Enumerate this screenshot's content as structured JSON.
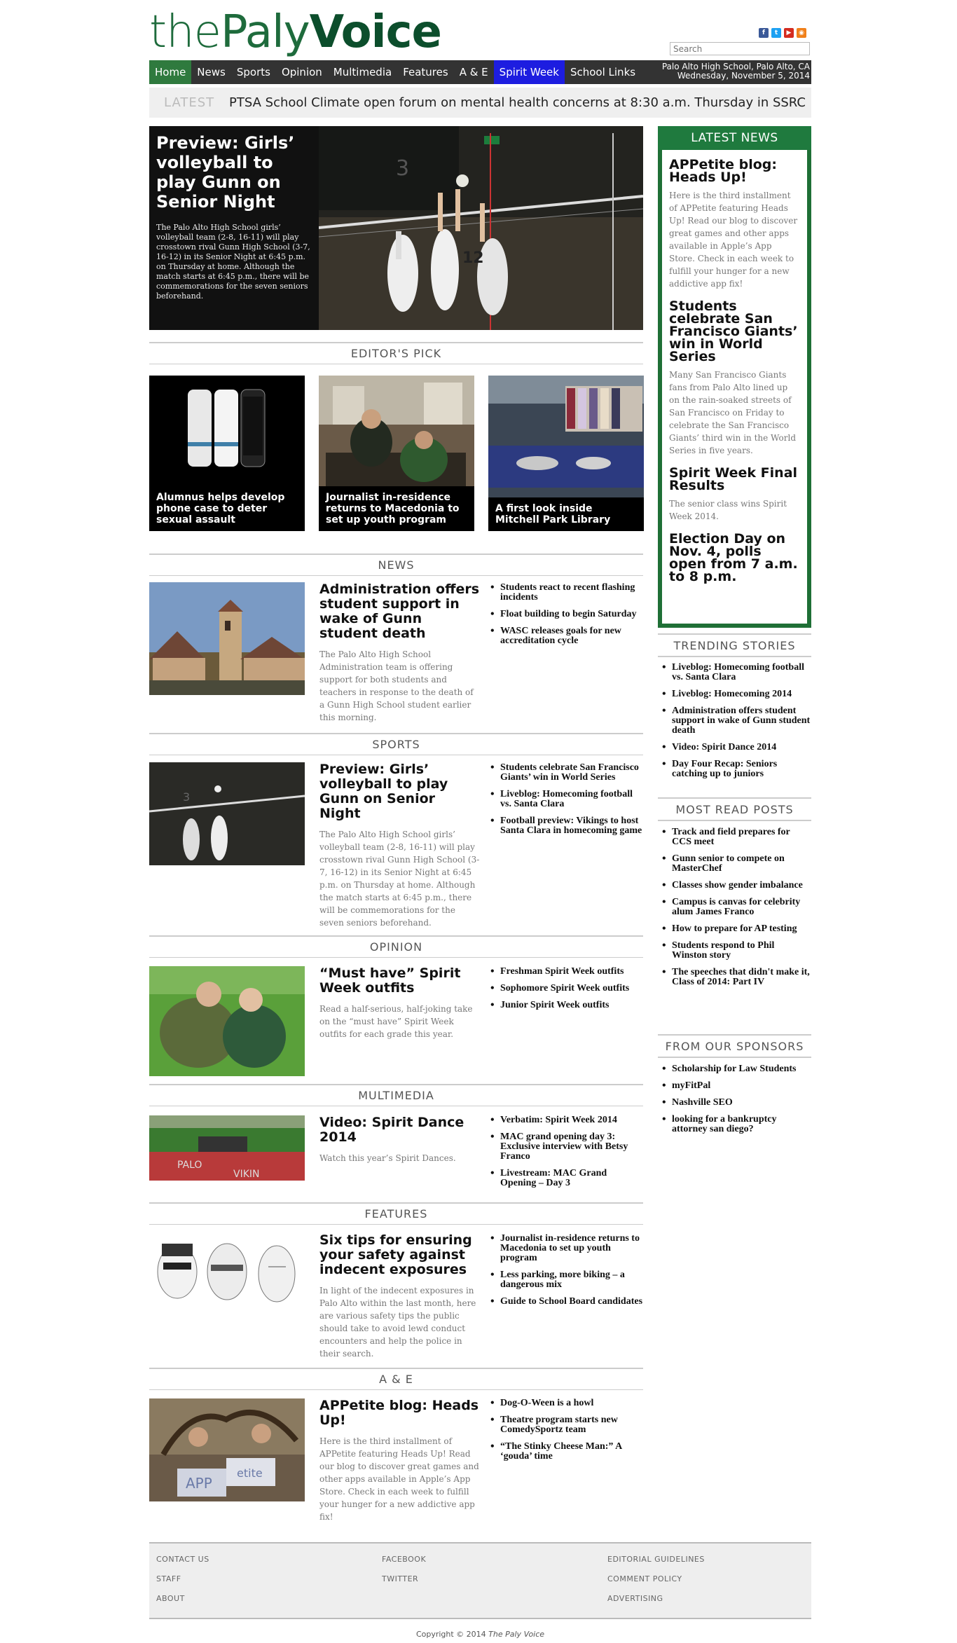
{
  "logo": {
    "part1": "the",
    "part2": "Paly",
    "part3": "Voice"
  },
  "social": {
    "icons": [
      "facebook-icon",
      "twitter-icon",
      "youtube-icon",
      "rss-icon"
    ]
  },
  "search": {
    "placeholder": "Search"
  },
  "nav": {
    "items": [
      "Home",
      "News",
      "Sports",
      "Opinion",
      "Multimedia",
      "Features",
      "A & E",
      "Spirit Week",
      "School Links"
    ],
    "info_line1": "Palo Alto High School, Palo Alto, CA",
    "info_line2": "Wednesday, November 5, 2014"
  },
  "ticker": {
    "label": "LATEST",
    "text": "PTSA School Climate open forum on mental health concerns at 8:30 a.m. Thursday in SSRC"
  },
  "hero": {
    "title": "Preview: Girls’ volleyball to play Gunn on Senior Night",
    "summary": "The Palo Alto High School girls’ volleyball team (2-8, 16-11) will play crosstown rival Gunn High School (3-7, 16-12) in its Senior Night at 6:45 p.m. on Thursday at home. Although the match starts at 6:45 p.m., there will be commemorations for the seven seniors beforehand."
  },
  "editors_pick": {
    "heading": "EDITOR'S PICK",
    "items": [
      "Alumnus helps develop phone case to deter sexual assault",
      "Journalist in-residence returns to Macedonia to set up youth program",
      "A first look inside Mitchell Park Library"
    ]
  },
  "sections": [
    {
      "heading": "NEWS",
      "title": "Administration offers student support in wake of Gunn student death",
      "summary": "The Palo Alto High School Administration team is offering support for both students and teachers in response to the death of a Gunn High School student earlier this morning.",
      "links": [
        "Students react to recent flashing incidents",
        "Float building to begin Saturday",
        "WASC releases goals for new accreditation cycle"
      ]
    },
    {
      "heading": "SPORTS",
      "title": "Preview: Girls’ volleyball to play Gunn on Senior Night",
      "summary": "The Palo Alto High School girls’ volleyball team (2-8, 16-11) will play crosstown rival Gunn High School (3-7, 16-12) in its Senior Night at 6:45 p.m. on Thursday at home. Although the match starts at 6:45 p.m., there will be commemorations for the seven seniors beforehand.",
      "links": [
        "Students celebrate San Francisco Giants’ win in World Series",
        "Liveblog: Homecoming football vs. Santa Clara",
        "Football preview: Vikings to host Santa Clara in homecoming game"
      ]
    },
    {
      "heading": "OPINION",
      "title": "“Must have” Spirit Week outfits",
      "summary": "Read a half-serious, half-joking take on the “must have” Spirit Week outfits for each grade this year.",
      "links": [
        "Freshman Spirit Week outfits",
        "Sophomore Spirit Week outfits",
        "Junior Spirit Week outfits"
      ]
    },
    {
      "heading": "MULTIMEDIA",
      "title": "Video: Spirit Dance 2014",
      "summary": "Watch this year’s Spirit Dances.",
      "links": [
        "Verbatim: Spirit Week 2014",
        "MAC grand opening day 3: Exclusive interview with Betsy Franco",
        "Livestream: MAC Grand Opening – Day 3"
      ]
    },
    {
      "heading": "FEATURES",
      "title": "Six tips for ensuring your safety against indecent exposures",
      "summary": "In light of the indecent exposures in Palo Alto within the last month, here are various safety tips the public should take to avoid lewd conduct encounters and help the police in their search.",
      "links": [
        "Journalist in-residence returns to Macedonia to set up youth program",
        "Less parking, more biking – a dangerous mix",
        "Guide to School Board candidates"
      ]
    },
    {
      "heading": "A & E",
      "title": "APPetite blog: Heads Up!",
      "summary": "Here is the third installment of APPetite featuring Heads Up! Read our blog to discover great games and other apps available in Apple’s App Store. Check in each week to fulfill your hunger for a new addictive app fix!",
      "links": [
        "Dog-O-Ween is a howl",
        "Theatre program starts new ComedySportz team",
        "“The Stinky Cheese Man:” A ‘gouda’ time"
      ]
    }
  ],
  "latest_news": {
    "heading": "LATEST NEWS",
    "items": [
      {
        "title": "APPetite blog: Heads Up!",
        "summary": "Here is the third installment of APPetite featuring Heads Up! Read our blog to discover great games and other apps available in Apple’s App Store. Check in each week to fulfill your hunger for a new addictive app fix!"
      },
      {
        "title": "Students celebrate San Francisco Giants’ win in World Series",
        "summary": "Many San Francisco Giants fans from Palo Alto lined up on the rain-soaked streets of San Francisco on Friday to celebrate the San Francisco Giants’ third win in the World Series in five years."
      },
      {
        "title": "Spirit Week Final Results",
        "summary": "The senior class wins Spirit Week 2014."
      },
      {
        "title": "Election Day on Nov. 4, polls open from 7 a.m. to 8 p.m.",
        "summary": ""
      }
    ]
  },
  "trending": {
    "heading": "TRENDING STORIES",
    "items": [
      "Liveblog: Homecoming football vs. Santa Clara",
      "Liveblog: Homecoming 2014",
      "Administration offers student support in wake of Gunn student death",
      "Video: Spirit Dance 2014",
      "Day Four Recap: Seniors catching up to juniors"
    ]
  },
  "most_read": {
    "heading": "MOST READ POSTS",
    "items": [
      "Track and field prepares for CCS meet",
      "Gunn senior to compete on MasterChef",
      "Classes show gender imbalance",
      "Campus is canvas for celebrity alum James Franco",
      "How to prepare for AP testing",
      "Students respond to Phil Winston story",
      "The speeches that didn't make it, Class of 2014: Part IV"
    ]
  },
  "sponsors": {
    "heading": "FROM OUR SPONSORS",
    "items": [
      "Scholarship for Law Students",
      "myFitPal",
      "Nashville SEO",
      "looking for a bankruptcy attorney san diego?"
    ]
  },
  "footer": {
    "col1": [
      "CONTACT US",
      "STAFF",
      "ABOUT"
    ],
    "col2": [
      "FACEBOOK",
      "TWITTER"
    ],
    "col3": [
      "EDITORIAL GUIDELINES",
      "COMMENT POLICY",
      "ADVERTISING"
    ],
    "copyright_prefix": "Copyright © 2014 ",
    "copyright_name": "The Paly Voice"
  }
}
